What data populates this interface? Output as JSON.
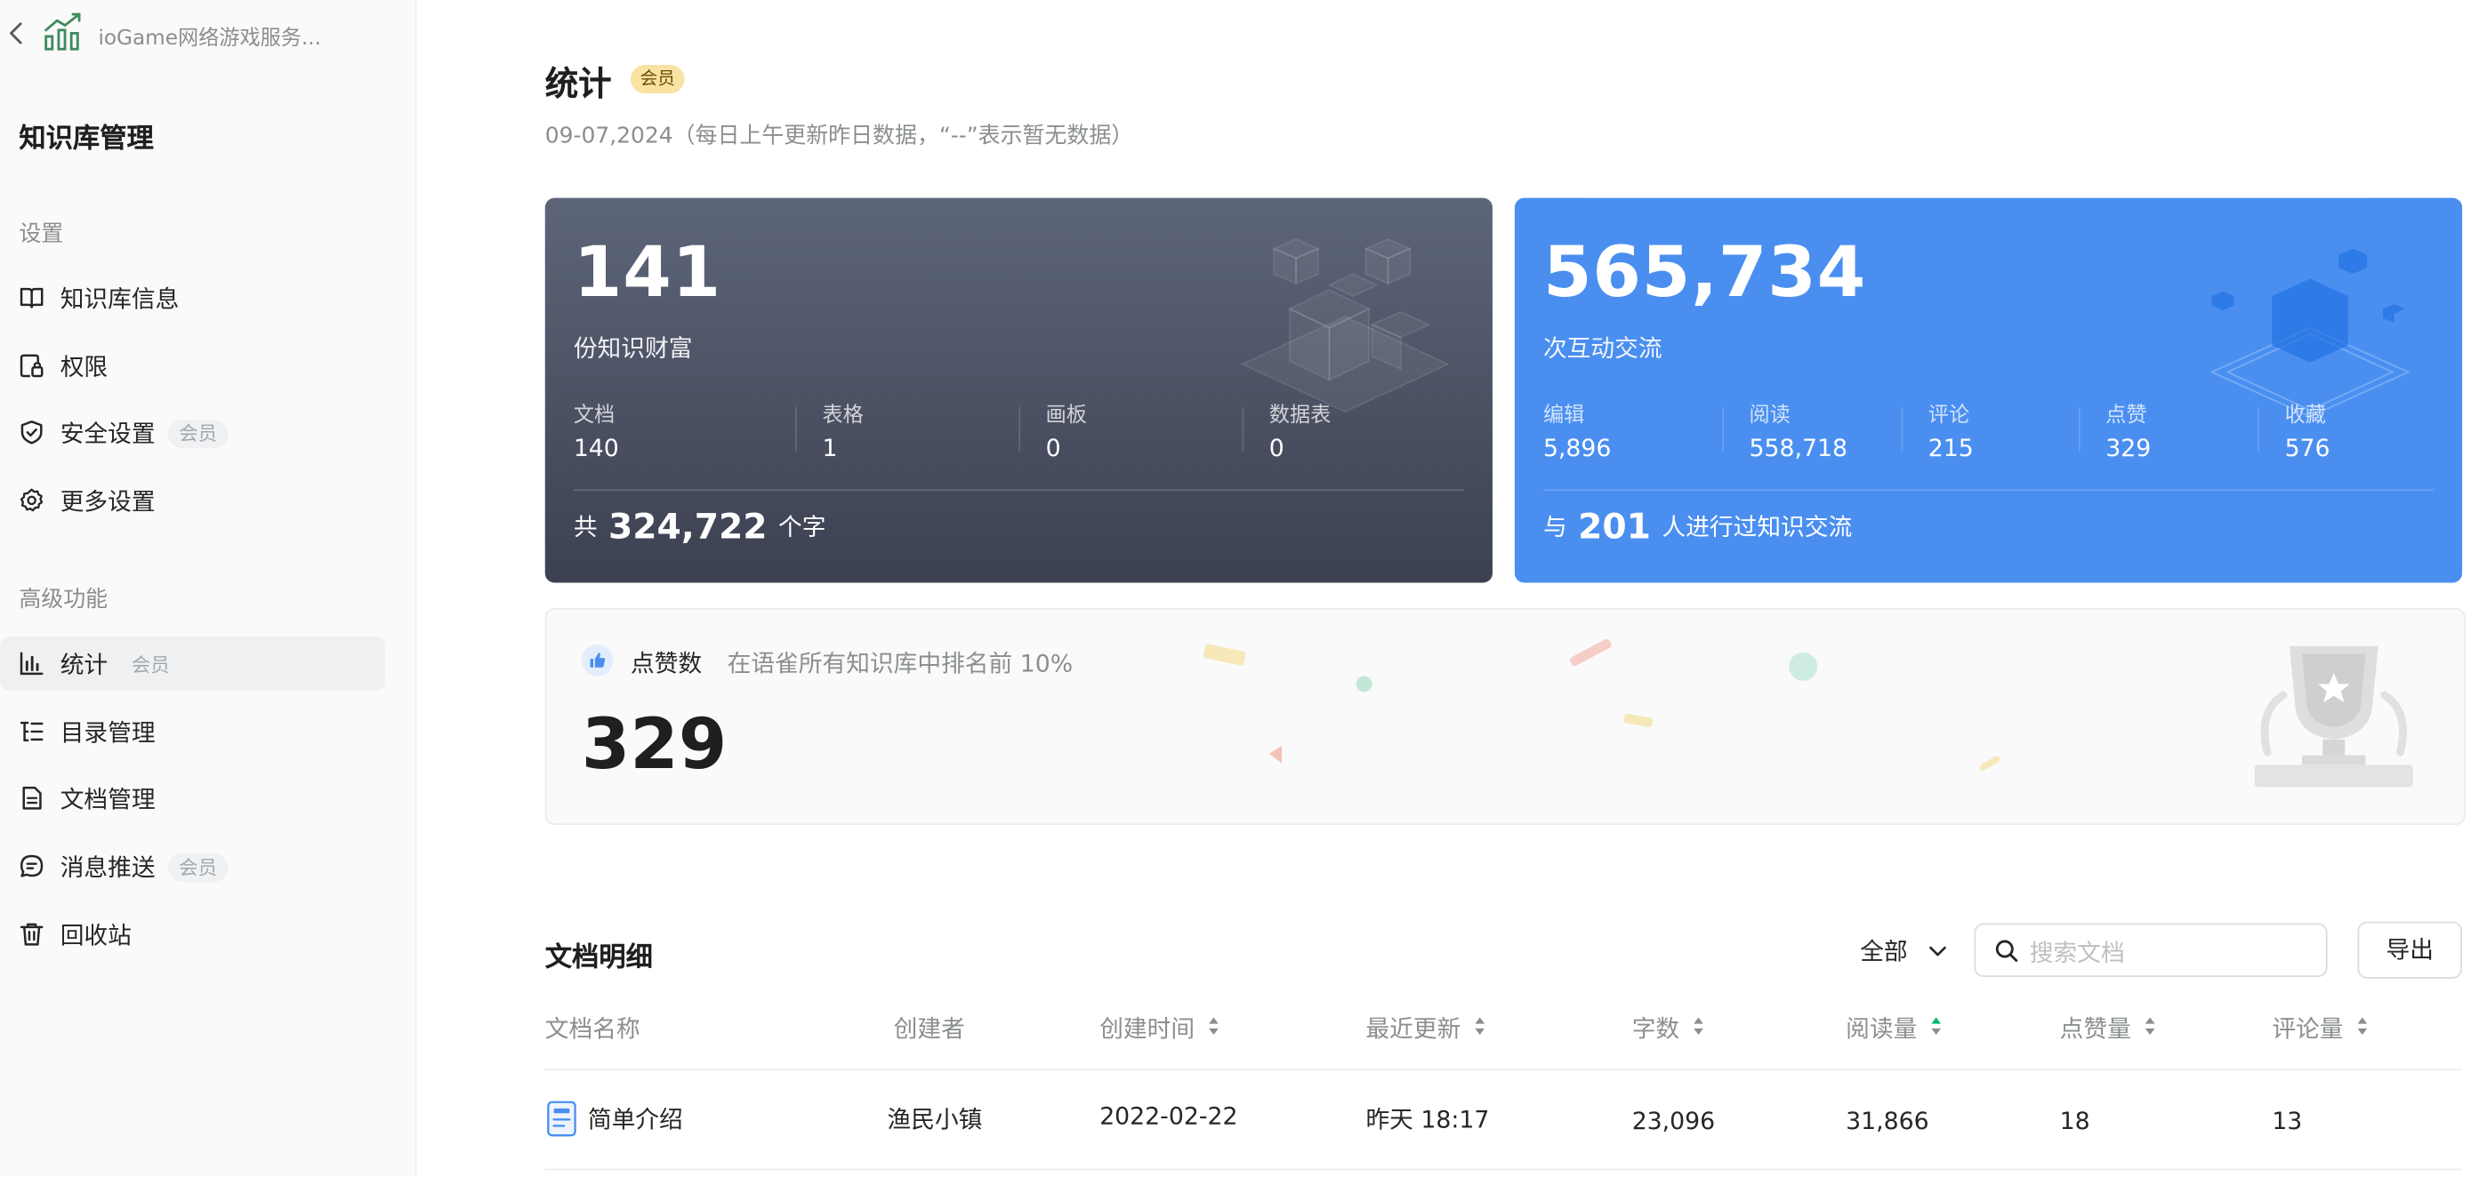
{
  "app": {
    "name": "ioGame网络游戏服务...",
    "back_icon": "chevron-left-icon",
    "app_icon": "chart-growth-icon"
  },
  "sidebar": {
    "title": "知识库管理",
    "sections": [
      {
        "title": "设置",
        "items": [
          {
            "label": "知识库信息",
            "icon": "book-icon",
            "badge": ""
          },
          {
            "label": "权限",
            "icon": "permission-lock-icon",
            "badge": ""
          },
          {
            "label": "安全设置",
            "icon": "shield-icon",
            "badge": "会员"
          },
          {
            "label": "更多设置",
            "icon": "gear-icon",
            "badge": ""
          }
        ]
      },
      {
        "title": "高级功能",
        "items": [
          {
            "label": "统计",
            "icon": "bar-chart-icon",
            "badge": "会员",
            "active": true
          },
          {
            "label": "目录管理",
            "icon": "list-tree-icon",
            "badge": ""
          },
          {
            "label": "文档管理",
            "icon": "document-icon",
            "badge": ""
          },
          {
            "label": "消息推送",
            "icon": "message-icon",
            "badge": "会员"
          },
          {
            "label": "回收站",
            "icon": "trash-icon",
            "badge": ""
          }
        ]
      }
    ]
  },
  "header": {
    "title": "统计",
    "badge": "会员",
    "subtitle": "09-07,2024（每日上午更新昨日数据，“--”表示暂无数据）"
  },
  "knowledge_card": {
    "value": "141",
    "label": "份知识财富",
    "stats": [
      {
        "label": "文档",
        "value": "140"
      },
      {
        "label": "表格",
        "value": "1"
      },
      {
        "label": "画板",
        "value": "0"
      },
      {
        "label": "数据表",
        "value": "0"
      }
    ],
    "footer_prefix": "共",
    "footer_value": "324,722",
    "footer_suffix": "个字",
    "bg_colors": [
      "#5d6579",
      "#3c4151"
    ]
  },
  "interaction_card": {
    "value": "565,734",
    "label": "次互动交流",
    "stats": [
      {
        "label": "编辑",
        "value": "5,896"
      },
      {
        "label": "阅读",
        "value": "558,718"
      },
      {
        "label": "评论",
        "value": "215"
      },
      {
        "label": "点赞",
        "value": "329"
      },
      {
        "label": "收藏",
        "value": "576"
      }
    ],
    "footer_prefix": "与",
    "footer_value": "201",
    "footer_suffix": "人进行过知识交流",
    "bg_color": "#4a8ff0"
  },
  "likes": {
    "icon": "thumbs-up-icon",
    "title": "点赞数",
    "desc": "在语雀所有知识库中排名前 10%",
    "value": "329"
  },
  "table": {
    "title": "文档明细",
    "filter": {
      "value": "全部",
      "icon": "chevron-down-icon"
    },
    "search": {
      "placeholder": "搜索文档",
      "icon": "search-icon"
    },
    "export_label": "导出",
    "columns": [
      {
        "label": "文档名称",
        "sortable": false
      },
      {
        "label": "创建者",
        "sortable": false
      },
      {
        "label": "创建时间",
        "sortable": true
      },
      {
        "label": "最近更新",
        "sortable": true
      },
      {
        "label": "字数",
        "sortable": true
      },
      {
        "label": "阅读量",
        "sortable": true,
        "active": true
      },
      {
        "label": "点赞量",
        "sortable": true
      },
      {
        "label": "评论量",
        "sortable": true
      }
    ],
    "rows": [
      {
        "name": "简单介绍",
        "icon": "doc-file-icon",
        "creator": "渔民小镇",
        "created": "2022-02-22",
        "updated": "昨天 18:17",
        "words": "23,096",
        "reads": "31,866",
        "likes": "18",
        "comments": "13"
      }
    ]
  },
  "colors": {
    "accent_blue": "#4a8ff0",
    "sort_active": "#00b96b",
    "vip_badge_bg": "#f8e3a3"
  }
}
